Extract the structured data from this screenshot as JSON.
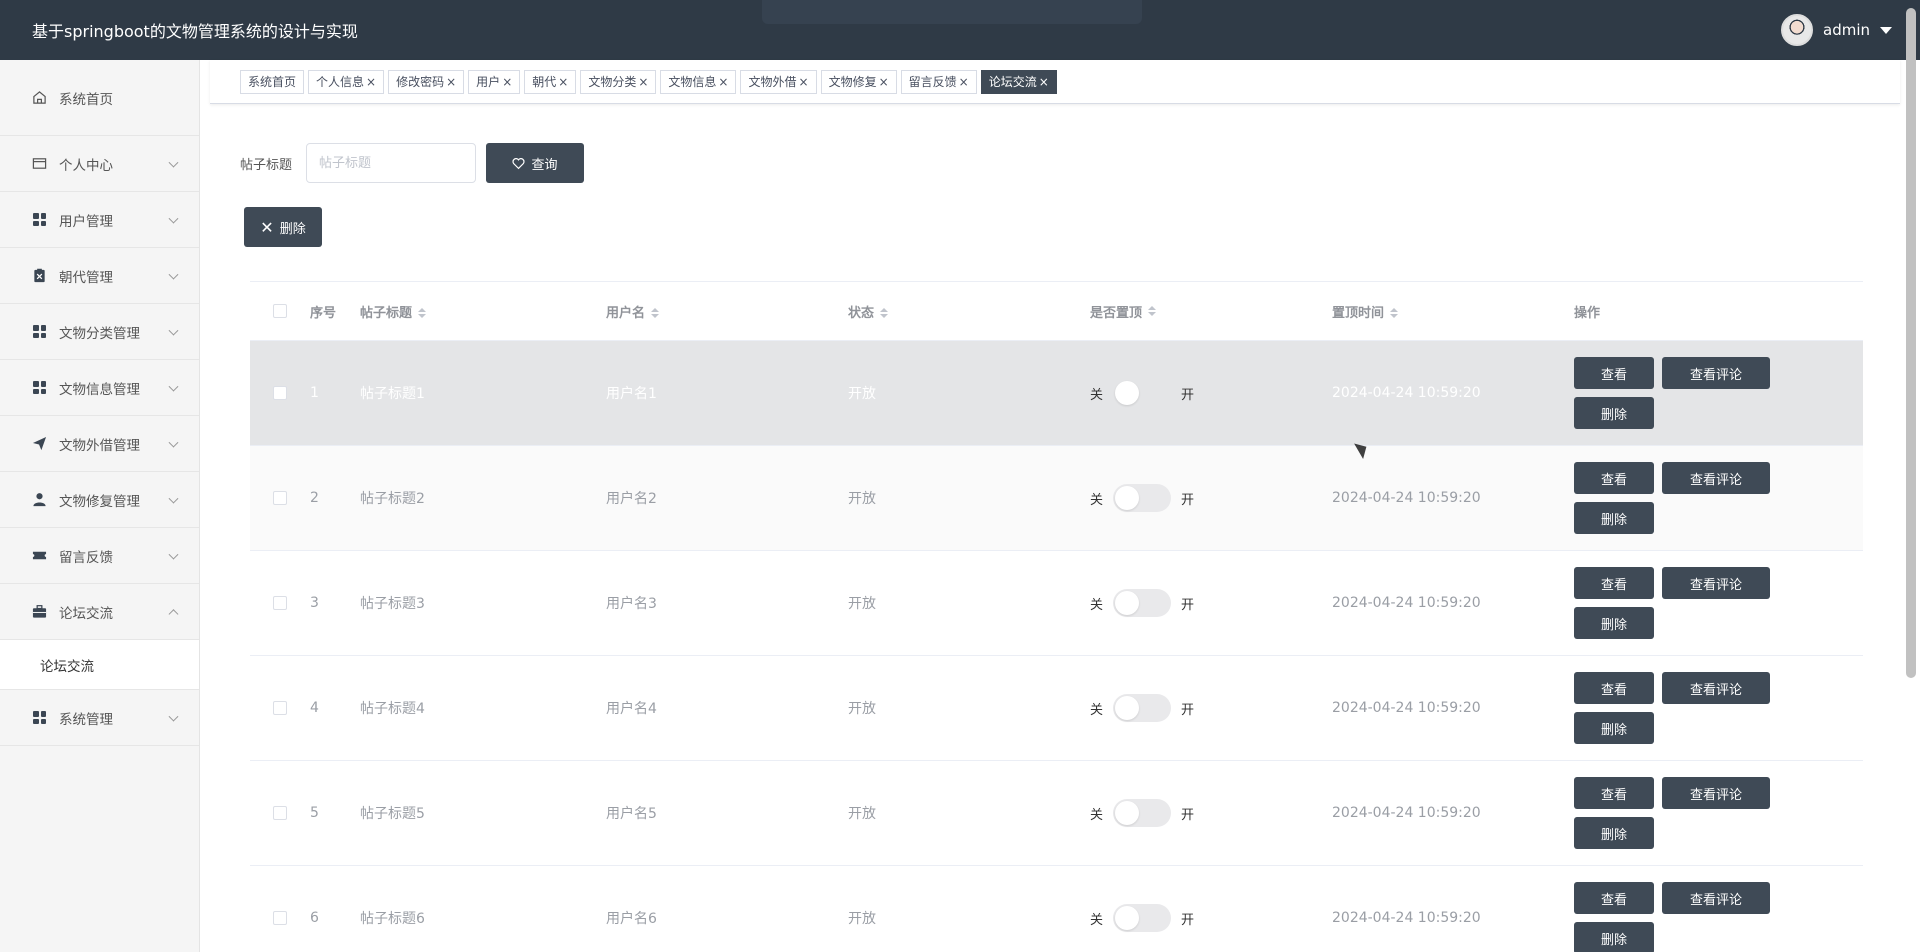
{
  "app": {
    "title": "基于springboot的文物管理系统的设计与实现",
    "user": "admin"
  },
  "sidebar": {
    "items": [
      {
        "label": "系统首页",
        "icon": "home-icon"
      },
      {
        "label": "个人中心",
        "icon": "card-icon"
      },
      {
        "label": "用户管理",
        "icon": "grid-icon"
      },
      {
        "label": "朝代管理",
        "icon": "clipboard-icon"
      },
      {
        "label": "文物分类管理",
        "icon": "grid-icon"
      },
      {
        "label": "文物信息管理",
        "icon": "grid-icon"
      },
      {
        "label": "文物外借管理",
        "icon": "send-icon"
      },
      {
        "label": "文物修复管理",
        "icon": "user-icon"
      },
      {
        "label": "留言反馈",
        "icon": "ticket-icon"
      },
      {
        "label": "论坛交流",
        "icon": "briefcase-icon"
      },
      {
        "label": "系统管理",
        "icon": "grid-icon"
      }
    ],
    "open_submenu": {
      "label": "论坛交流"
    }
  },
  "tabs": [
    {
      "label": "系统首页",
      "closable": false
    },
    {
      "label": "个人信息",
      "closable": true
    },
    {
      "label": "修改密码",
      "closable": true
    },
    {
      "label": "用户",
      "closable": true
    },
    {
      "label": "朝代",
      "closable": true
    },
    {
      "label": "文物分类",
      "closable": true
    },
    {
      "label": "文物信息",
      "closable": true
    },
    {
      "label": "文物外借",
      "closable": true
    },
    {
      "label": "文物修复",
      "closable": true
    },
    {
      "label": "留言反馈",
      "closable": true
    },
    {
      "label": "论坛交流",
      "closable": true,
      "active": true
    }
  ],
  "search": {
    "label": "帖子标题",
    "placeholder": "帖子标题",
    "button": "查询"
  },
  "toolbar": {
    "delete_label": "删除"
  },
  "table": {
    "headers": {
      "index": "序号",
      "title": "帖子标题",
      "username": "用户名",
      "status": "状态",
      "top": "是否置顶",
      "top_time": "置顶时间",
      "ops": "操作"
    },
    "switch_off": "关",
    "switch_on": "开",
    "ops": {
      "view": "查看",
      "comments": "查看评论",
      "delete": "删除"
    },
    "rows": [
      {
        "index": "1",
        "title": "帖子标题1",
        "username": "用户名1",
        "status": "开放",
        "top_time": "2024-04-24 10:59:20"
      },
      {
        "index": "2",
        "title": "帖子标题2",
        "username": "用户名2",
        "status": "开放",
        "top_time": "2024-04-24 10:59:20"
      },
      {
        "index": "3",
        "title": "帖子标题3",
        "username": "用户名3",
        "status": "开放",
        "top_time": "2024-04-24 10:59:20"
      },
      {
        "index": "4",
        "title": "帖子标题4",
        "username": "用户名4",
        "status": "开放",
        "top_time": "2024-04-24 10:59:20"
      },
      {
        "index": "5",
        "title": "帖子标题5",
        "username": "用户名5",
        "status": "开放",
        "top_time": "2024-04-24 10:59:20"
      },
      {
        "index": "6",
        "title": "帖子标题6",
        "username": "用户名6",
        "status": "开放",
        "top_time": "2024-04-24 10:59:20"
      }
    ]
  }
}
